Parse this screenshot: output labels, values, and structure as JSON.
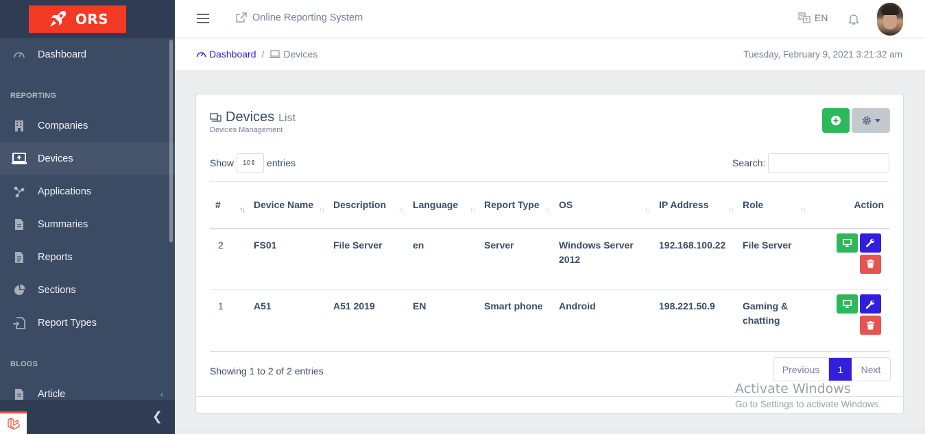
{
  "brand": {
    "logo_text": "ORS"
  },
  "sidebar": {
    "items": [
      {
        "label": "Dashboard",
        "icon": "speedometer-icon"
      },
      {
        "label": "Companies",
        "icon": "building-icon"
      },
      {
        "label": "Devices",
        "icon": "laptop-icon",
        "active": true
      },
      {
        "label": "Applications",
        "icon": "hub-icon"
      },
      {
        "label": "Summaries",
        "icon": "document-icon"
      },
      {
        "label": "Reports",
        "icon": "report-icon"
      },
      {
        "label": "Sections",
        "icon": "pie-icon"
      },
      {
        "label": "Report Types",
        "icon": "file-input-icon"
      },
      {
        "label": "Article",
        "icon": "article-icon"
      }
    ],
    "sections": {
      "reporting": "REPORTING",
      "blogs": "BLOGS"
    }
  },
  "header": {
    "title": "Online Reporting System",
    "language": "EN"
  },
  "breadcrumb": {
    "home": "Dashboard",
    "current": "Devices",
    "datetime": "Tuesday, February 9, 2021 3:21:32 am"
  },
  "card": {
    "title": "Devices",
    "title_suffix": "List",
    "subtitle": "Devices Management"
  },
  "table_controls": {
    "show_label": "Show",
    "entries_value": "10",
    "entries_label": "entries",
    "search_label": "Search:",
    "search_value": ""
  },
  "table": {
    "headers": {
      "num": "#",
      "name": "Device Name",
      "description": "Description",
      "language": "Language",
      "report_type": "Report Type",
      "os": "OS",
      "ip": "IP Address",
      "role": "Role",
      "action": "Action"
    },
    "rows": [
      {
        "num": "2",
        "name": "FS01",
        "description": "File Server",
        "language": "en",
        "report_type": "Server",
        "os": "Windows Server 2012",
        "ip": "192.168.100.22",
        "role": "File Server"
      },
      {
        "num": "1",
        "name": "A51",
        "description": "A51 2019",
        "language": "EN",
        "report_type": "Smart phone",
        "os": "Android",
        "ip": "198.221.50.9",
        "role": "Gaming & chatting"
      }
    ]
  },
  "pagination": {
    "info": "Showing 1 to 2 of 2 entries",
    "previous": "Previous",
    "current": "1",
    "next": "Next"
  },
  "watermark": {
    "line1": "Activate Windows",
    "line2": "Go to Settings to activate Windows."
  },
  "colors": {
    "sidebar": "#3c4b64",
    "primary": "#321fdb",
    "success": "#2eb85c",
    "danger": "#e55353",
    "brand_red": "#f23a24"
  }
}
